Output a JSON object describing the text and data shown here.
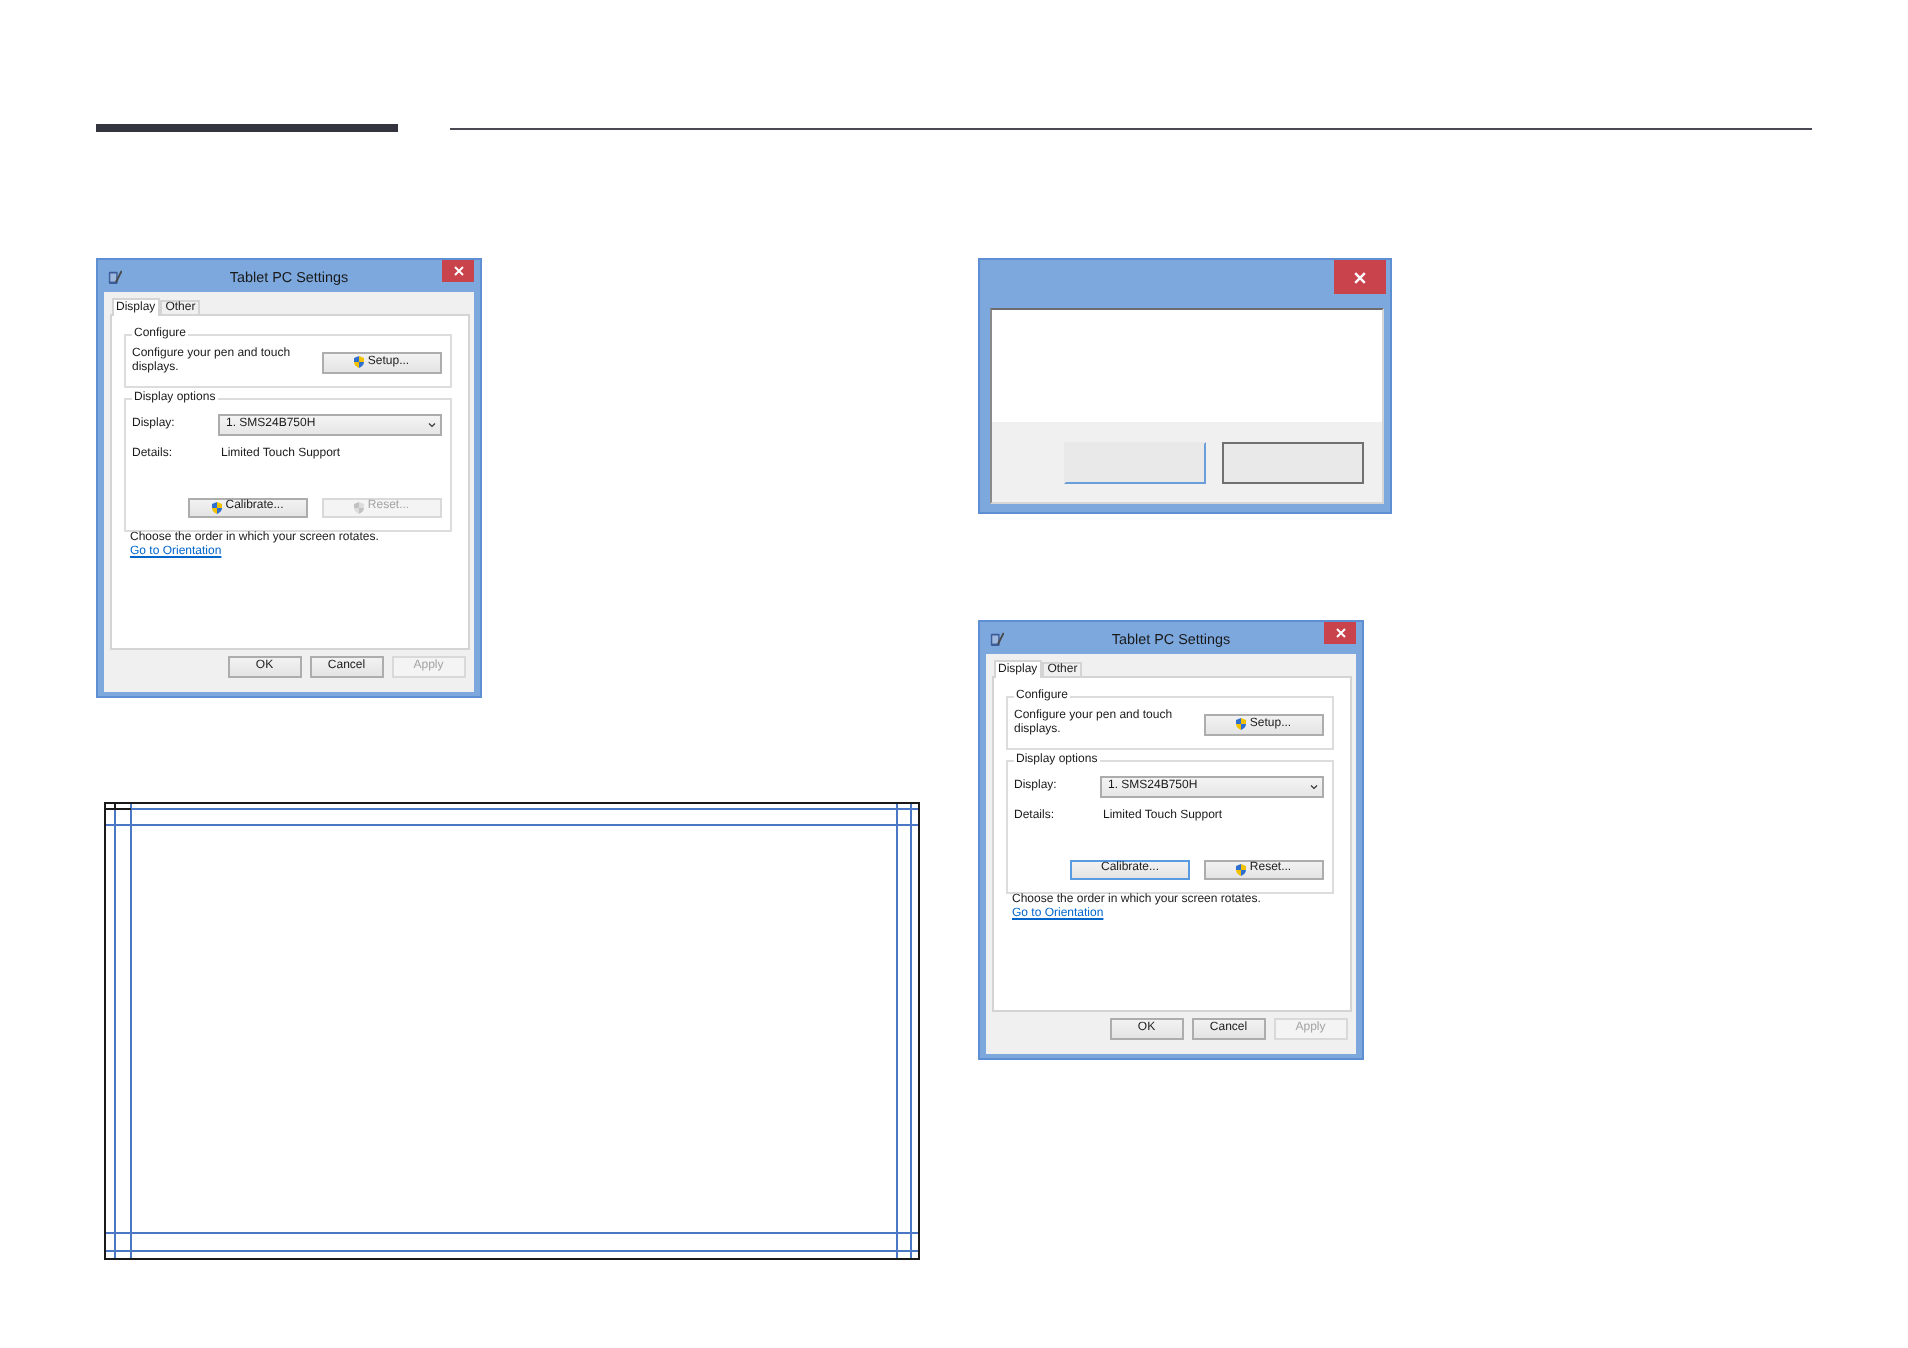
{
  "left_column": {
    "settings_dialog": {
      "title": "Tablet PC Settings",
      "tabs": [
        {
          "label": "Display",
          "selected": true
        },
        {
          "label": "Other",
          "selected": false
        }
      ],
      "configure": {
        "heading": "Configure",
        "description": "Configure your pen and touch displays.",
        "button": {
          "label": "Setup...",
          "shield": true,
          "disabled": false,
          "focused": false
        }
      },
      "display_options": {
        "heading": "Display options",
        "display_label": "Display:",
        "display_value": "1. SMS24B750H",
        "details_label": "Details:",
        "details_value": "Limited Touch Support",
        "buttons": [
          {
            "label": "Calibrate...",
            "shield": true,
            "disabled": false,
            "focused": false
          },
          {
            "label": "Reset...",
            "shield": true,
            "disabled": true,
            "focused": false
          }
        ]
      },
      "rotation_text": "Choose the order in which your screen rotates.",
      "orientation_link": "Go to Orientation",
      "footer_buttons": [
        {
          "label": "OK",
          "disabled": false
        },
        {
          "label": "Cancel",
          "disabled": false
        },
        {
          "label": "Apply",
          "disabled": true
        }
      ]
    }
  },
  "right_column": {
    "message_dialog": {
      "buttons": [
        {
          "focused": true
        },
        {
          "focused": false
        }
      ]
    },
    "settings_dialog": {
      "title": "Tablet PC Settings",
      "tabs": [
        {
          "label": "Display",
          "selected": true
        },
        {
          "label": "Other",
          "selected": false
        }
      ],
      "configure": {
        "heading": "Configure",
        "description": "Configure your pen and touch displays.",
        "button": {
          "label": "Setup...",
          "shield": true,
          "disabled": false,
          "focused": false
        }
      },
      "display_options": {
        "heading": "Display options",
        "display_label": "Display:",
        "display_value": "1. SMS24B750H",
        "details_label": "Details:",
        "details_value": "Limited Touch Support",
        "buttons": [
          {
            "label": "Calibrate...",
            "shield": false,
            "disabled": false,
            "focused": true
          },
          {
            "label": "Reset...",
            "shield": true,
            "disabled": false,
            "focused": false
          }
        ]
      },
      "rotation_text": "Choose the order in which your screen rotates.",
      "orientation_link": "Go to Orientation",
      "footer_buttons": [
        {
          "label": "OK",
          "disabled": false
        },
        {
          "label": "Cancel",
          "disabled": false
        },
        {
          "label": "Apply",
          "disabled": true
        }
      ]
    }
  }
}
